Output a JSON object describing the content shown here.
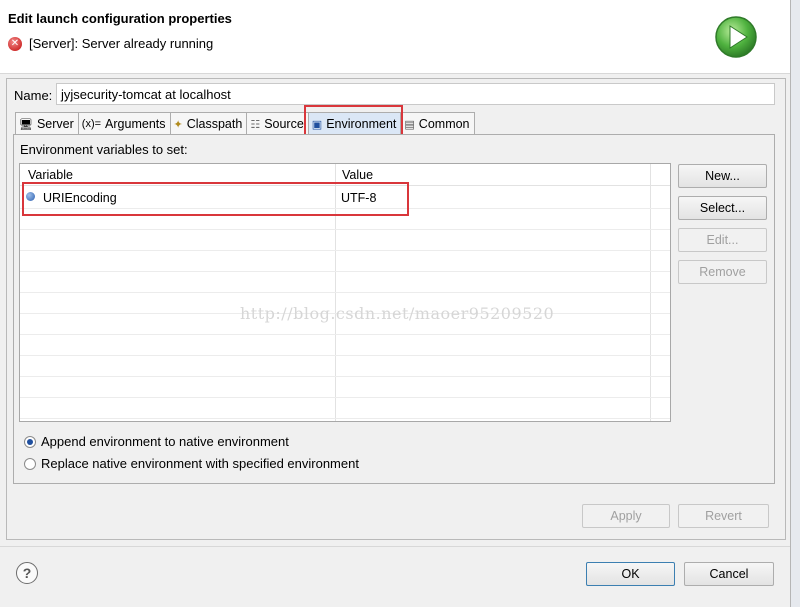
{
  "dialog": {
    "title": "Edit launch configuration properties",
    "error_message": "[Server]: Server already running",
    "icons": {
      "error": "error-icon",
      "run": "run-icon"
    }
  },
  "name_field": {
    "label": "Name:",
    "value": "jyjsecurity-tomcat at localhost"
  },
  "tabs": [
    {
      "label": "Server",
      "icon": "server-icon"
    },
    {
      "label": "Arguments",
      "icon": "arguments-icon",
      "icon_text": "(x)="
    },
    {
      "label": "Classpath",
      "icon": "classpath-icon"
    },
    {
      "label": "Source",
      "icon": "source-icon"
    },
    {
      "label": "Environment",
      "icon": "environment-icon",
      "selected": true
    },
    {
      "label": "Common",
      "icon": "common-icon"
    }
  ],
  "environment": {
    "section_label": "Environment variables to set:",
    "columns": [
      "Variable",
      "Value"
    ],
    "rows": [
      {
        "variable": "URIEncoding",
        "value": "UTF-8"
      }
    ]
  },
  "side_buttons": {
    "new": "New...",
    "select": "Select...",
    "edit": "Edit...",
    "remove": "Remove"
  },
  "options": {
    "append": "Append environment to native environment",
    "replace": "Replace native environment with specified environment",
    "selected": "append"
  },
  "actions": {
    "apply": "Apply",
    "revert": "Revert",
    "ok": "OK",
    "cancel": "Cancel"
  },
  "watermark": "http://blog.csdn.net/maoer95209520",
  "colors": {
    "highlight": "#d9363b",
    "accent": "#3c7fb1",
    "run_green": "#3ea13a"
  }
}
